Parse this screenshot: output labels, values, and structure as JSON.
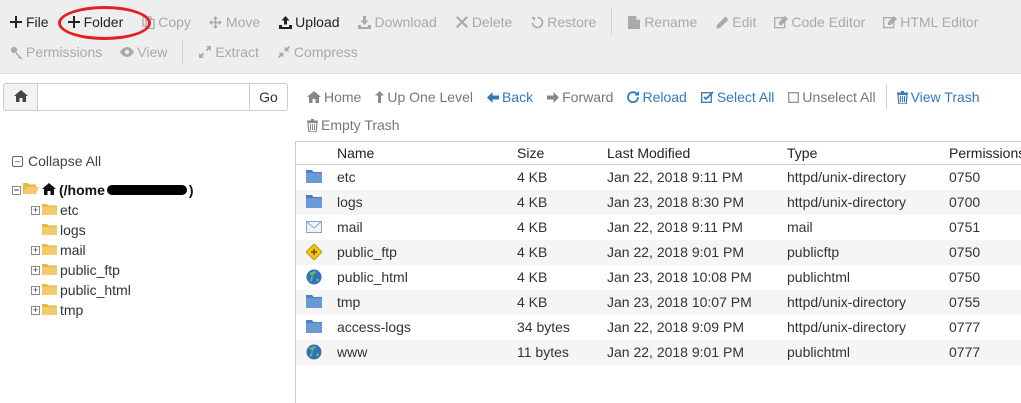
{
  "toolbar": {
    "row1": [
      {
        "label": "File",
        "icon": "plus-icon",
        "enabled": true
      },
      {
        "label": "Folder",
        "icon": "plus-icon",
        "enabled": true
      },
      {
        "label": "Copy",
        "icon": "copy-icon",
        "enabled": false
      },
      {
        "label": "Move",
        "icon": "move-icon",
        "enabled": false
      },
      {
        "label": "Upload",
        "icon": "upload-icon",
        "enabled": true
      },
      {
        "label": "Download",
        "icon": "download-icon",
        "enabled": false
      },
      {
        "label": "Delete",
        "icon": "delete-icon",
        "enabled": false
      },
      {
        "label": "Restore",
        "icon": "restore-icon",
        "enabled": false
      },
      {
        "label": "Rename",
        "icon": "rename-icon",
        "enabled": false
      },
      {
        "label": "Edit",
        "icon": "pencil-icon",
        "enabled": false
      },
      {
        "label": "Code Editor",
        "icon": "code-editor-icon",
        "enabled": false
      },
      {
        "label": "HTML Editor",
        "icon": "html-editor-icon",
        "enabled": false
      }
    ],
    "row2": [
      {
        "label": "Permissions",
        "icon": "key-icon",
        "enabled": false
      },
      {
        "label": "View",
        "icon": "eye-icon",
        "enabled": false
      },
      {
        "label": "Extract",
        "icon": "extract-icon",
        "enabled": false
      },
      {
        "label": "Compress",
        "icon": "compress-icon",
        "enabled": false
      }
    ]
  },
  "left_panel": {
    "go_label": "Go",
    "path_value": "",
    "collapse_all_label": "Collapse All",
    "tree_root_label_prefix": "(/home",
    "tree_root_label_suffix": ")",
    "tree_children": [
      {
        "label": "etc",
        "expandable": true
      },
      {
        "label": "logs",
        "expandable": false
      },
      {
        "label": "mail",
        "expandable": true
      },
      {
        "label": "public_ftp",
        "expandable": true
      },
      {
        "label": "public_html",
        "expandable": true
      },
      {
        "label": "tmp",
        "expandable": true
      }
    ]
  },
  "nav": {
    "home": "Home",
    "up_one_level": "Up One Level",
    "back": "Back",
    "forward": "Forward",
    "reload": "Reload",
    "select_all": "Select All",
    "unselect_all": "Unselect All",
    "view_trash": "View Trash",
    "empty_trash": "Empty Trash"
  },
  "table": {
    "headers": {
      "name": "Name",
      "size": "Size",
      "modified": "Last Modified",
      "type": "Type",
      "permissions": "Permissions"
    },
    "rows": [
      {
        "icon": "folder-icon",
        "name": "etc",
        "size": "4 KB",
        "modified": "Jan 22, 2018 9:11 PM",
        "type": "httpd/unix-directory",
        "perm": "0750"
      },
      {
        "icon": "folder-icon",
        "name": "logs",
        "size": "4 KB",
        "modified": "Jan 23, 2018 8:30 PM",
        "type": "httpd/unix-directory",
        "perm": "0700"
      },
      {
        "icon": "mail-icon",
        "name": "mail",
        "size": "4 KB",
        "modified": "Jan 22, 2018 9:11 PM",
        "type": "mail",
        "perm": "0751"
      },
      {
        "icon": "publicftp-icon",
        "name": "public_ftp",
        "size": "4 KB",
        "modified": "Jan 22, 2018 9:01 PM",
        "type": "publicftp",
        "perm": "0750"
      },
      {
        "icon": "globe-icon",
        "name": "public_html",
        "size": "4 KB",
        "modified": "Jan 23, 2018 10:08 PM",
        "type": "publichtml",
        "perm": "0750"
      },
      {
        "icon": "folder-icon",
        "name": "tmp",
        "size": "4 KB",
        "modified": "Jan 23, 2018 10:07 PM",
        "type": "httpd/unix-directory",
        "perm": "0755"
      },
      {
        "icon": "folder-icon",
        "name": "access-logs",
        "size": "34 bytes",
        "modified": "Jan 22, 2018 9:09 PM",
        "type": "httpd/unix-directory",
        "perm": "0777"
      },
      {
        "icon": "globe-icon",
        "name": "www",
        "size": "11 bytes",
        "modified": "Jan 22, 2018 9:01 PM",
        "type": "publichtml",
        "perm": "0777"
      }
    ]
  },
  "colors": {
    "toolbar_bg": "#eeeeee",
    "enabled_text": "#222222",
    "disabled_text": "#a9a9a9",
    "link_blue": "#3479b8",
    "annotation_red": "#e32020",
    "folder_yellow": "#e6b84a",
    "folder_blue": "#5b88c7"
  }
}
